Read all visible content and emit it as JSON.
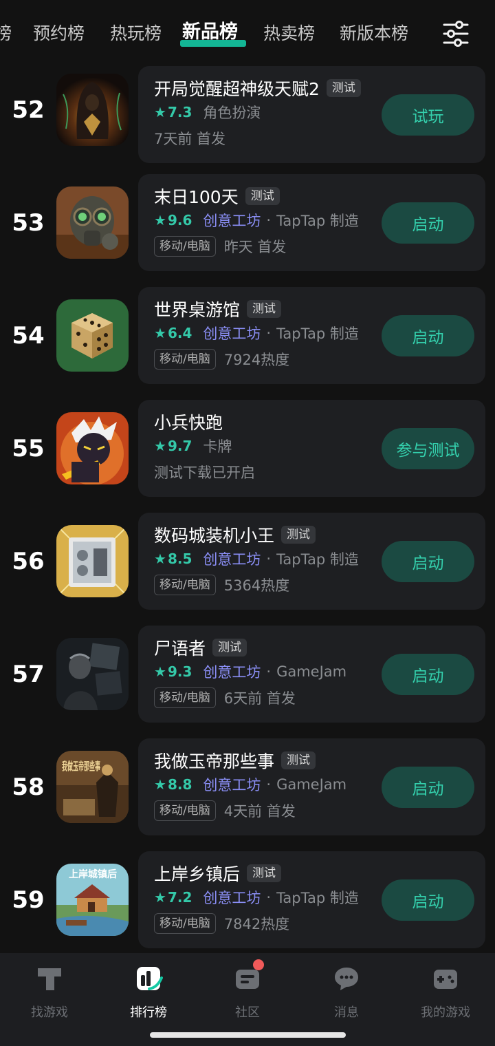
{
  "tabs": [
    {
      "label": "榜",
      "active": false
    },
    {
      "label": "预约榜",
      "active": false
    },
    {
      "label": "热玩榜",
      "active": false
    },
    {
      "label": "新品榜",
      "active": true
    },
    {
      "label": "热卖榜",
      "active": false
    },
    {
      "label": "新版本榜",
      "active": false
    }
  ],
  "filter_icon": "sliders-icon",
  "games": [
    {
      "rank": "52",
      "title": "开局觉醒超神级天赋2",
      "tag": "测试",
      "score": "7.3",
      "genre": "角色扮演",
      "studio": "",
      "maker": "",
      "platform": "",
      "info": "7天前 首发",
      "button": "试玩"
    },
    {
      "rank": "53",
      "title": "末日100天",
      "tag": "测试",
      "score": "9.6",
      "genre": "",
      "studio": "创意工坊",
      "maker": "TapTap 制造",
      "platform": "移动/电脑",
      "info": "昨天 首发",
      "button": "启动"
    },
    {
      "rank": "54",
      "title": "世界桌游馆",
      "tag": "测试",
      "score": "6.4",
      "genre": "",
      "studio": "创意工坊",
      "maker": "TapTap 制造",
      "platform": "移动/电脑",
      "info": "7924热度",
      "button": "启动"
    },
    {
      "rank": "55",
      "title": "小兵快跑",
      "tag": "",
      "score": "9.7",
      "genre": "卡牌",
      "studio": "",
      "maker": "",
      "platform": "",
      "info": "测试下载已开启",
      "button": "参与测试"
    },
    {
      "rank": "56",
      "title": "数码城装机小王",
      "tag": "测试",
      "score": "8.5",
      "genre": "",
      "studio": "创意工坊",
      "maker": "TapTap 制造",
      "platform": "移动/电脑",
      "info": "5364热度",
      "button": "启动"
    },
    {
      "rank": "57",
      "title": "尸语者",
      "tag": "测试",
      "score": "9.3",
      "genre": "",
      "studio": "创意工坊",
      "maker": "GameJam",
      "platform": "移动/电脑",
      "info": "6天前 首发",
      "button": "启动"
    },
    {
      "rank": "58",
      "title": "我做玉帝那些事",
      "tag": "测试",
      "score": "8.8",
      "genre": "",
      "studio": "创意工坊",
      "maker": "GameJam",
      "platform": "移动/电脑",
      "info": "4天前 首发",
      "button": "启动"
    },
    {
      "rank": "59",
      "title": "上岸乡镇后",
      "tag": "测试",
      "score": "7.2",
      "genre": "",
      "studio": "创意工坊",
      "maker": "TapTap 制造",
      "platform": "移动/电脑",
      "info": "7842热度",
      "button": "启动"
    }
  ],
  "icon_text": {
    "game58": "我做玉帝那些事",
    "game59": "上岸城镇后"
  },
  "bottom_nav": [
    {
      "label": "找游戏",
      "icon": "taptap-logo-icon",
      "active": false
    },
    {
      "label": "排行榜",
      "icon": "ranking-icon",
      "active": true
    },
    {
      "label": "社区",
      "icon": "community-icon",
      "active": false
    },
    {
      "label": "消息",
      "icon": "message-icon",
      "active": false
    },
    {
      "label": "我的游戏",
      "icon": "gamepad-icon",
      "active": false
    }
  ],
  "colors": {
    "accent": "#34c9a9",
    "button_bg": "#1b4a42",
    "studio": "#8b8ff7",
    "background": "#121212",
    "card": "#1e1f22",
    "notification": "#f05a5a"
  }
}
